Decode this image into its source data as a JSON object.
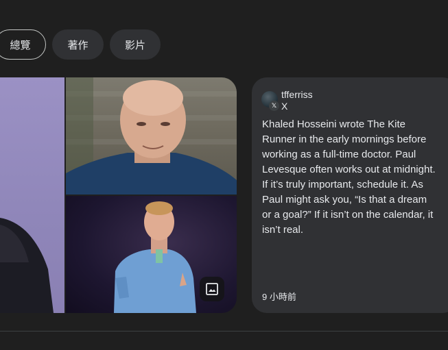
{
  "tabs": [
    {
      "label": "總覽",
      "active": true
    },
    {
      "label": "著作",
      "active": false
    },
    {
      "label": "影片",
      "active": false
    }
  ],
  "post": {
    "handle": "tfferriss",
    "source": "X",
    "source_badge": "𝕏",
    "text": "Khaled Hosseini wrote The Kite Runner in the early mornings before working as a full-time doctor. Paul Levesque often works out at midnight. If it’s truly important, schedule it. As Paul might ask you, “Is that a dream or a goal?” If it isn’t on the calendar, it isn’t real.",
    "timestamp": "9 小時前"
  },
  "icons": {
    "expand": "image-icon",
    "source": "x-logo-icon"
  },
  "colors": {
    "background": "#1f1f1f",
    "card": "#303134",
    "text": "#e8eaed"
  }
}
